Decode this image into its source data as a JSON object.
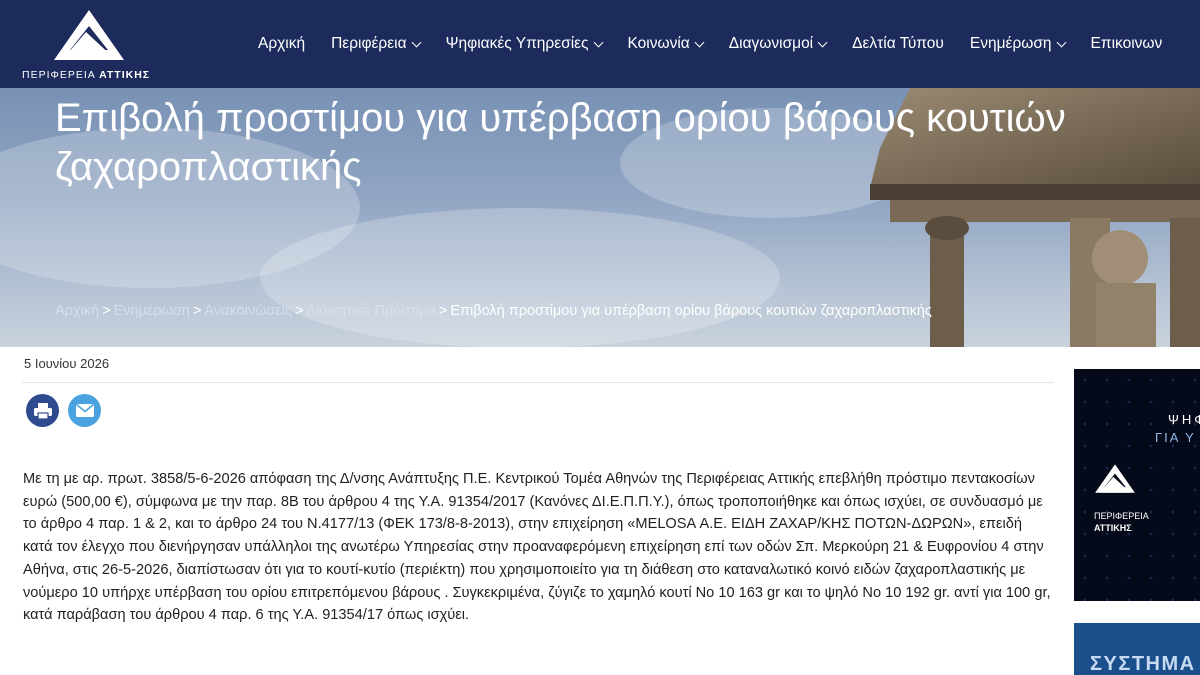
{
  "header": {
    "logo_text_regular": "ΠΕΡΙΦΕΡΕΙΑ",
    "logo_text_bold": "ΑΤΤΙΚΗΣ",
    "nav": [
      {
        "label": "Αρχική",
        "has_dropdown": false
      },
      {
        "label": "Περιφέρεια",
        "has_dropdown": true
      },
      {
        "label": "Ψηφιακές Υπηρεσίες",
        "has_dropdown": true
      },
      {
        "label": "Κοινωνία",
        "has_dropdown": true
      },
      {
        "label": "Διαγωνισμοί",
        "has_dropdown": true
      },
      {
        "label": "Δελτία Τύπου",
        "has_dropdown": false
      },
      {
        "label": "Ενημέρωση",
        "has_dropdown": true
      },
      {
        "label": "Επικοινων",
        "has_dropdown": false
      }
    ]
  },
  "hero": {
    "title": "Επιβολή προστίμου για υπέρβαση ορίου βάρους κουτιών ζαχαροπλαστικής",
    "breadcrumb": {
      "links": [
        "Αρχική",
        "Ενημέρωση",
        "Ανακοινώσεις",
        "Διοικητικά Πρόστιμα"
      ],
      "separator": ">",
      "current": "Επιβολή προστίμου για υπέρβαση ορίου βάρους κουτιών ζαχαροπλαστικής"
    }
  },
  "article": {
    "date": "5 Ιουνίου 2026",
    "share": {
      "print_icon": "print-icon",
      "email_icon": "email-icon"
    },
    "body": "Με τη με αρ. πρωτ. 3858/5-6-2026 απόφαση της Δ/νσης Ανάπτυξης Π.Ε. Κεντρικού Τομέα Αθηνών της Περιφέρειας Αττικής επεβλήθη πρόστιμο πεντακοσίων ευρώ  (500,00  €), σύμφωνα με την παρ. 8Β του άρθρου 4 της Υ.Α. 91354/2017 (Κανόνες ΔΙ.Ε.Π.Π.Υ.), όπως τροποποιήθηκε  και όπως ισχύει,  σε  συνδυασμό  με  το  άρθρο  4  παρ.  1 & 2,  και το άρθρο 24 του Ν.4177/13 (ΦΕΚ 173/8-8-2013), στην επιχείρηση «MELOSA Α.Ε. ΕΙΔΗ ΖΑΧΑΡ/ΚΗΣ ΠΟΤΩΝ-ΔΩΡΩΝ», επειδή κατά τον έλεγχο που διενήργησαν υπάλληλοι της ανωτέρω Υπηρεσίας στην προαναφερόμενη επιχείρηση επί των οδών Σπ. Μερκούρη 21 & Ευφρονίου 4 στην  Αθήνα, στις 26-5-2026, διαπίστωσαν ότι για το κουτί-κυτίο (περιέκτη) που χρησιμοποιείτο για τη διάθεση στο καταναλωτικό κοινό ειδών ζαχαροπλαστικής με νούμερο 10 υπήρχε υπέρβαση του ορίου επιτρεπόμενου βάρους . Συγκεκριμένα, ζύγιζε το χαμηλό κουτί  Νο 10 163 gr και το ψηλό Νο 10  192 gr. αντί για  100 gr, κατά παράβαση  του άρθρου 4 παρ. 6 της Υ.Α. 91354/17 όπως ισχύει."
  },
  "sidebar": {
    "banner1": {
      "line1": "ΨΗΦ",
      "line2": "ΓΙΑ Υ",
      "logo_text_regular": "ΠΕΡΙΦΕΡΕΙΑ",
      "logo_text_bold": "ΑΤΤΙΚΗΣ"
    },
    "banner2": {
      "text": "ΣΥΣΤΗΜΑ"
    }
  },
  "colors": {
    "header_bg": "#1d2b5c",
    "print_button": "#2f4b8f",
    "email_button": "#4aa3e0"
  }
}
